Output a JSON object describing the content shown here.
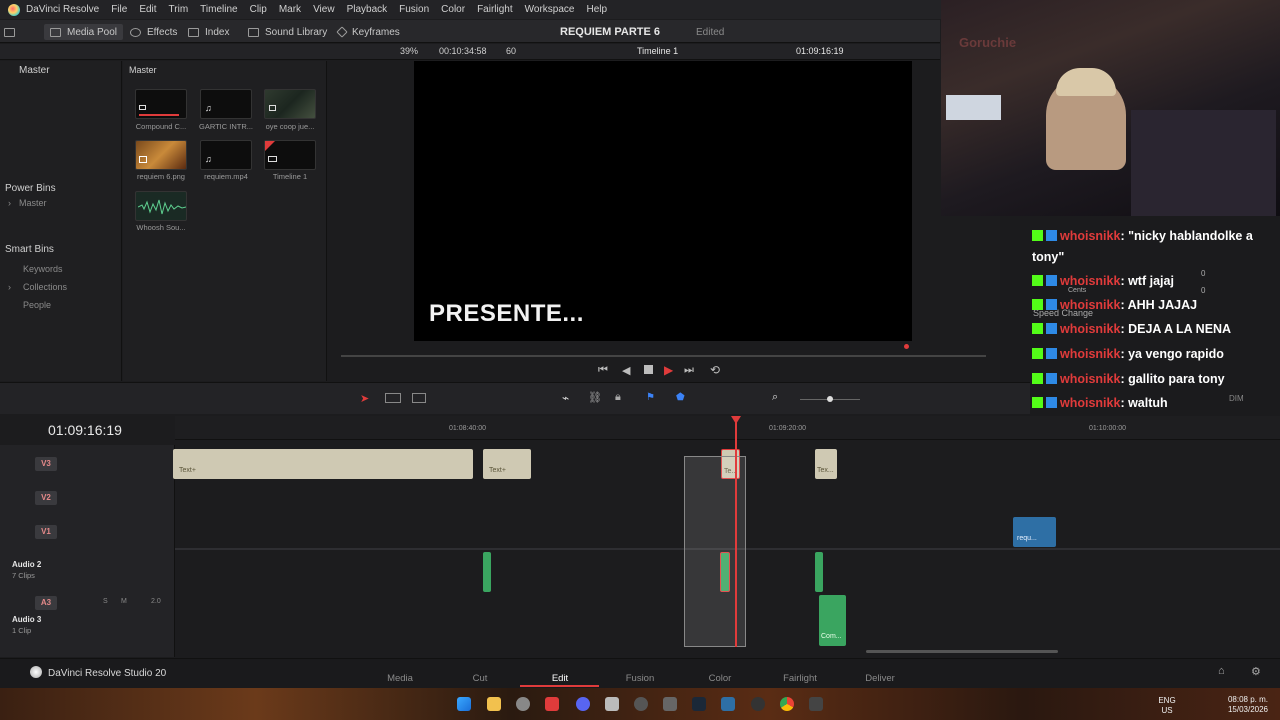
{
  "app": {
    "name": "DaVinci Resolve",
    "menu": [
      "File",
      "Edit",
      "Trim",
      "Timeline",
      "Clip",
      "Mark",
      "View",
      "Playback",
      "Fusion",
      "Color",
      "Fairlight",
      "Workspace",
      "Help"
    ]
  },
  "toolbar": {
    "media_pool": "Media Pool",
    "effects": "Effects",
    "index": "Index",
    "sound_library": "Sound Library",
    "keyframes": "Keyframes",
    "project_title": "REQUIEM PARTE 6",
    "project_status": "Edited"
  },
  "viewer": {
    "zoom": "39%",
    "source_timecode": "00:10:34:58",
    "fps": "60",
    "timeline_name": "Timeline 1",
    "timecode": "01:09:16:19",
    "caption": "PRESENTE..."
  },
  "sidebar": {
    "master": "Master",
    "power_bins_title": "Power Bins",
    "power_bins_item": "Master",
    "smart_bins_title": "Smart Bins",
    "smart_bins_items": [
      "Keywords",
      "Collections",
      "People"
    ]
  },
  "bin": {
    "title": "Master",
    "items": [
      {
        "label": "Compound C...",
        "icon": "compound-icon"
      },
      {
        "label": "GARTIC INTR...",
        "icon": "music-icon"
      },
      {
        "label": "oye coop jue...",
        "icon": "video-icon"
      },
      {
        "label": "requiem 6.png",
        "icon": "image-icon"
      },
      {
        "label": "requiem.mp4",
        "icon": "music-icon"
      },
      {
        "label": "Timeline 1",
        "icon": "timeline-icon"
      },
      {
        "label": "Whoosh Sou...",
        "icon": "waveform-icon"
      }
    ]
  },
  "webcam": {
    "sign": "Goruchie"
  },
  "chat": {
    "messages": [
      {
        "user": "whoisnikk",
        "text": ": \"nicky hablandolke a",
        "cont": "tony\""
      },
      {
        "user": "whoisnikk",
        "text": ": wtf jajaj"
      },
      {
        "user": "whoisnikk",
        "text": ": AHH JAJAJ"
      },
      {
        "user": "whoisnikk",
        "text": ": DEJA A LA NENA"
      },
      {
        "user": "whoisnikk",
        "text": ": ya vengo rapido"
      },
      {
        "user": "whoisnikk",
        "text": ": gallito para tony"
      },
      {
        "user": "whoisnikk",
        "text": ": waltuh"
      }
    ],
    "overlay": {
      "speed_change": "Speed Change",
      "cents": "Cents",
      "zero_a": "0",
      "zero_b": "0",
      "dim": "DIM"
    }
  },
  "timeline": {
    "timecode": "01:09:16:19",
    "ruler_labels": [
      "01:08:40:00",
      "01:09:20:00",
      "01:10:00:00"
    ],
    "tracks": [
      {
        "id": "V3"
      },
      {
        "id": "V2"
      },
      {
        "id": "V1"
      },
      {
        "name": "Audio 2",
        "clips": "7 Clips"
      },
      {
        "id": "A3",
        "name": "Audio 3",
        "clips": "1 Clip",
        "s": "S",
        "m": "M",
        "level": "2.0"
      }
    ],
    "clips": {
      "text1": "Text+",
      "text2": "Text+",
      "text3": "Te...",
      "text4": "Tex...",
      "video1": "requ...",
      "audio_comp": "Com..."
    }
  },
  "bottom_nav": {
    "brand": "DaVinci Resolve Studio 20",
    "pages": [
      "Media",
      "Cut",
      "Edit",
      "Fusion",
      "Color",
      "Fairlight",
      "Deliver"
    ],
    "active": "Edit"
  },
  "taskbar": {
    "lang": "ENG",
    "region": "US",
    "time": "08:08 p. m.",
    "date": "15/03/2026"
  },
  "colors": {
    "accent": "#e03b3b",
    "kick": "#53fc18",
    "text_clip": "#cfc9b3",
    "video_clip": "#2e6fa5",
    "audio_clip": "#3aa560"
  }
}
